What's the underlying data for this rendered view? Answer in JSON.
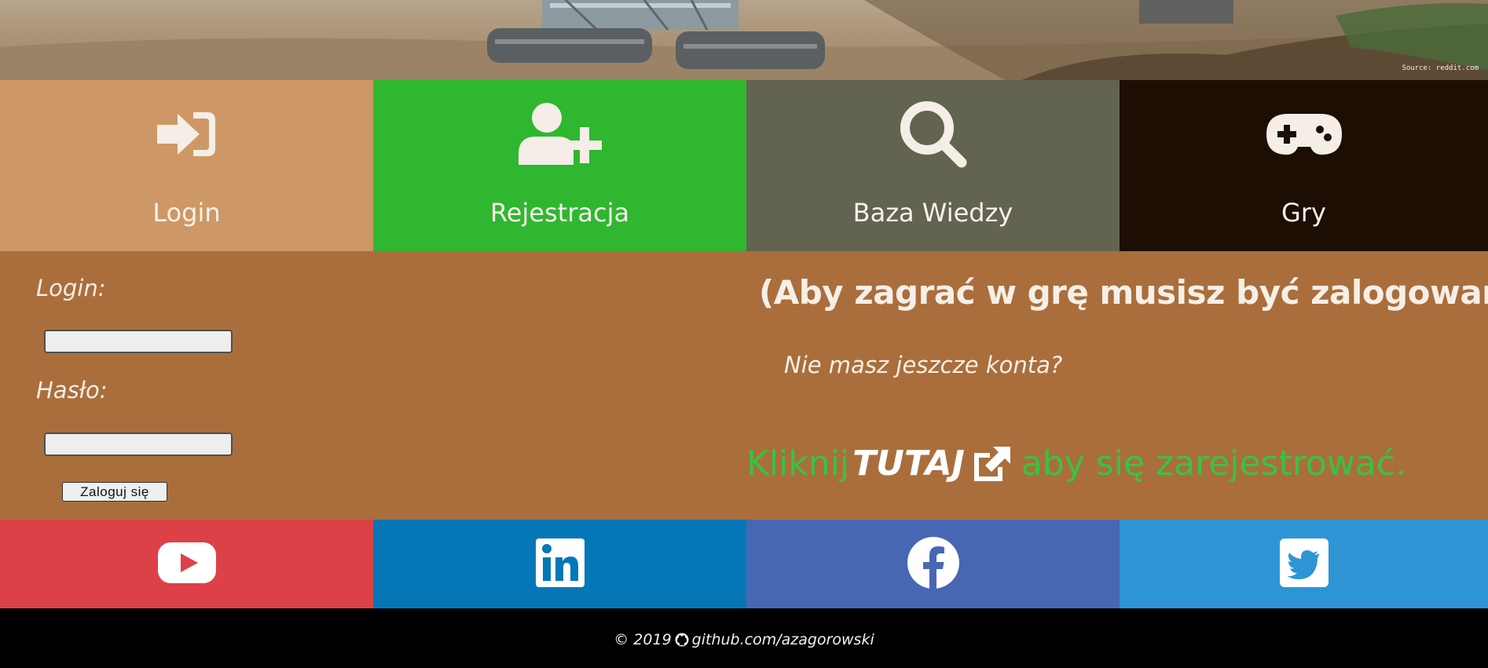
{
  "banner": {
    "source_text": "Source: reddit.com"
  },
  "nav": {
    "tiles": [
      {
        "label": "Login",
        "icon": "sign-in-icon",
        "color": "#cd9866"
      },
      {
        "label": "Rejestracja",
        "icon": "user-plus-icon",
        "color": "#2fb72f"
      },
      {
        "label": "Baza Wiedzy",
        "icon": "search-icon",
        "color": "#626350"
      },
      {
        "label": "Gry",
        "icon": "gamepad-icon",
        "color": "#1c0e03"
      }
    ]
  },
  "login_form": {
    "login_label": "Login:",
    "login_value": "",
    "password_label": "Hasło:",
    "password_value": "",
    "submit_label": "Zaloguj się"
  },
  "info": {
    "headline": "(Aby zagrać w grę musisz być zalogowany)",
    "no_account": "Nie masz jeszcze konta?",
    "cta_prefix": "Kliknij",
    "cta_link": "TUTAJ",
    "cta_suffix": "aby się zarejestrować.",
    "cta_color": "#39c33f"
  },
  "social": [
    {
      "name": "youtube",
      "icon": "youtube-icon",
      "color": "#dc4148"
    },
    {
      "name": "linkedin",
      "icon": "linkedin-icon",
      "color": "#0577b7"
    },
    {
      "name": "facebook",
      "icon": "facebook-icon",
      "color": "#4867b3"
    },
    {
      "name": "twitter",
      "icon": "twitter-icon",
      "color": "#2e95d4"
    }
  ],
  "footer": {
    "copyright": "© 2019",
    "link": "github.com/azagorowski"
  }
}
